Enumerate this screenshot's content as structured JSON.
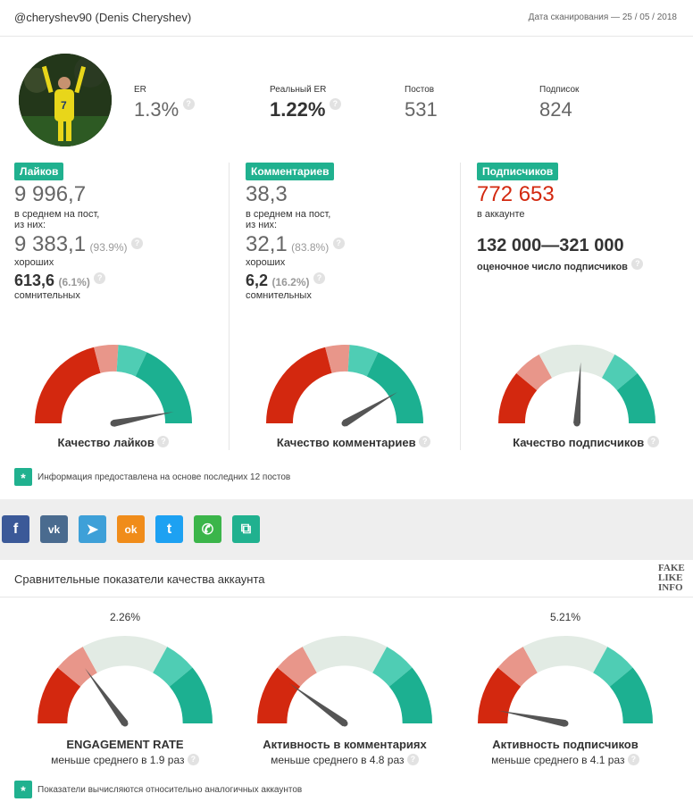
{
  "header": {
    "title": "@cheryshev90 (Denis Cheryshev)",
    "scan_date": "Дата сканирования — 25 / 05 / 2018"
  },
  "profile": {
    "er_label": "ER",
    "er_value": "1.3%",
    "real_er_label": "Реальный ER",
    "real_er_value": "1.22%",
    "posts_label": "Постов",
    "posts_value": "531",
    "subs_label": "Подписок",
    "subs_value": "824"
  },
  "likes": {
    "tag": "Лайков",
    "avg": "9 996,7",
    "avg_caption_1": "в среднем на пост,",
    "avg_caption_2": "из них:",
    "good": "9 383,1",
    "good_pct": "(93.9%)",
    "good_caption": "хороших",
    "doubt": "613,6",
    "doubt_pct": "(6.1%)",
    "doubt_caption": "сомнительных",
    "gauge_title": "Качество лайков",
    "gauge_level": 0.94
  },
  "comments": {
    "tag": "Комментариев",
    "avg": "38,3",
    "avg_caption_1": "в среднем на пост,",
    "avg_caption_2": "из них:",
    "good": "32,1",
    "good_pct": "(83.8%)",
    "good_caption": "хороших",
    "doubt": "6,2",
    "doubt_pct": "(16.2%)",
    "doubt_caption": "сомнительных",
    "gauge_title": "Качество комментариев",
    "gauge_level": 0.83
  },
  "followers": {
    "tag": "Подписчиков",
    "count": "772 653",
    "count_caption": "в аккаунте",
    "estimate": "132 000—321 000",
    "estimate_caption": "оценочное число подписчиков",
    "gauge_title": "Качество подписчиков",
    "gauge_level": 0.52
  },
  "note1": "Информация предоставлена на основе последних 12 постов",
  "share": [
    {
      "name": "facebook-icon",
      "glyph": "f",
      "color": "#3b5998"
    },
    {
      "name": "vk-icon",
      "glyph": "vk",
      "color": "#4a6b8f"
    },
    {
      "name": "telegram-icon",
      "glyph": "➤",
      "color": "#3ea0d8"
    },
    {
      "name": "odnoklassniki-icon",
      "glyph": "ok",
      "color": "#f08c1a"
    },
    {
      "name": "twitter-icon",
      "glyph": "t",
      "color": "#1da1f2"
    },
    {
      "name": "whatsapp-icon",
      "glyph": "✆",
      "color": "#3bb54a"
    },
    {
      "name": "copy-icon",
      "glyph": "⧉",
      "color": "#20b18f"
    }
  ],
  "compare": {
    "title": "Сравнительные показатели качества аккаунта",
    "logo": "FAKE LIKE INFO",
    "er": {
      "top": "2.26%",
      "title": "ENGAGEMENT RATE",
      "sub": "меньше среднего в 1.9 раз",
      "level": 0.3
    },
    "comments": {
      "top": "",
      "title": "Активность в комментариях",
      "sub": "меньше среднего в 4.8 раз",
      "level": 0.2
    },
    "followers": {
      "top": "5.21%",
      "title": "Активность подписчиков",
      "sub": "меньше среднего в 4.1 раз",
      "level": 0.06
    }
  },
  "note2": "Показатели вычисляются относительно аналогичных аккаунтов",
  "colors": {
    "red": "#d3280f",
    "salmon": "#e8968a",
    "light": "#e2ebe4",
    "mint": "#4fcdb4",
    "teal": "#1cb091"
  }
}
